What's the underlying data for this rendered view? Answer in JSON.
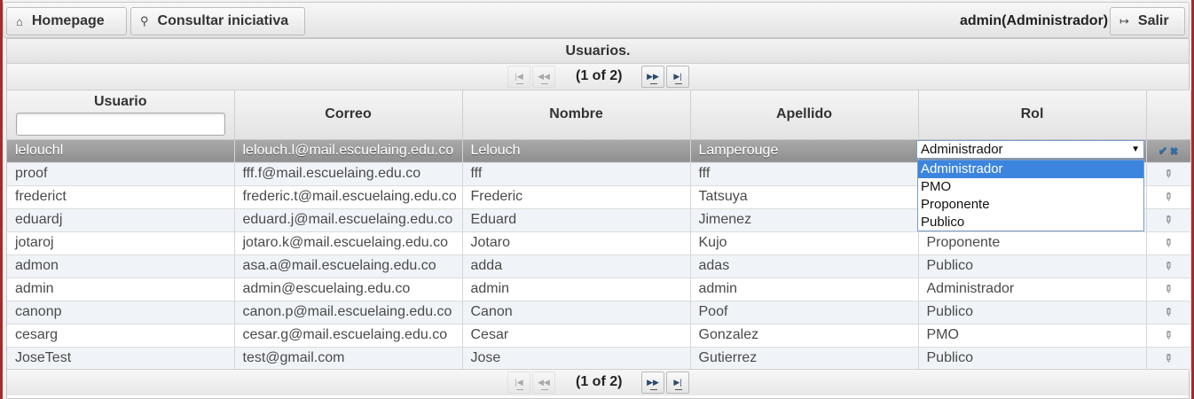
{
  "menubar": {
    "home_label": "Homepage",
    "search_label": "Consultar iniciativa",
    "user_label": "admin(Administrador)",
    "logout_label": "Salir"
  },
  "table": {
    "caption": "Usuarios.",
    "page_report": "(1 of 2)",
    "columns": [
      "Usuario",
      "Correo",
      "Nombre",
      "Apellido",
      "Rol"
    ],
    "filter_value": "",
    "rows": [
      {
        "usuario": "lelouchl",
        "correo": "lelouch.l@mail.escuelaing.edu.co",
        "nombre": "Lelouch",
        "apellido": "Lamperouge",
        "rol": "Administrador"
      },
      {
        "usuario": "proof",
        "correo": "fff.f@mail.escuelaing.edu.co",
        "nombre": "fff",
        "apellido": "fff",
        "rol": ""
      },
      {
        "usuario": "frederict",
        "correo": "frederic.t@mail.escuelaing.edu.co",
        "nombre": "Frederic",
        "apellido": "Tatsuya",
        "rol": ""
      },
      {
        "usuario": "eduardj",
        "correo": "eduard.j@mail.escuelaing.edu.co",
        "nombre": "Eduard",
        "apellido": "Jimenez",
        "rol": ""
      },
      {
        "usuario": "jotaroj",
        "correo": "jotaro.k@mail.escuelaing.edu.co",
        "nombre": "Jotaro",
        "apellido": "Kujo",
        "rol": "Proponente"
      },
      {
        "usuario": "admon",
        "correo": "asa.a@mail.escuelaing.edu.co",
        "nombre": "adda",
        "apellido": "adas",
        "rol": "Publico"
      },
      {
        "usuario": "admin",
        "correo": "admin@escuelaing.edu.co",
        "nombre": "admin",
        "apellido": "admin",
        "rol": "Administrador"
      },
      {
        "usuario": "canonp",
        "correo": "canon.p@mail.escuelaing.edu.co",
        "nombre": "Canon",
        "apellido": "Poof",
        "rol": "Publico"
      },
      {
        "usuario": "cesarg",
        "correo": "cesar.g@mail.escuelaing.edu.co",
        "nombre": "Cesar",
        "apellido": "Gonzalez",
        "rol": "PMO"
      },
      {
        "usuario": "JoseTest",
        "correo": "test@gmail.com",
        "nombre": "Jose",
        "apellido": "Gutierrez",
        "rol": "Publico"
      }
    ],
    "role_select": {
      "selected": "Administrador",
      "options": [
        "Administrador",
        "PMO",
        "Proponente",
        "Publico"
      ]
    }
  },
  "icons": {
    "home": "home-icon",
    "search": "search-icon",
    "logout": "logout-icon",
    "edit": "pencil-icon",
    "save": "check-icon",
    "cancel": "close-icon"
  },
  "colors": {
    "frame_border": "#a92a2a",
    "selected_option": "#3c85df",
    "editing_row": "#9a9a9a"
  }
}
